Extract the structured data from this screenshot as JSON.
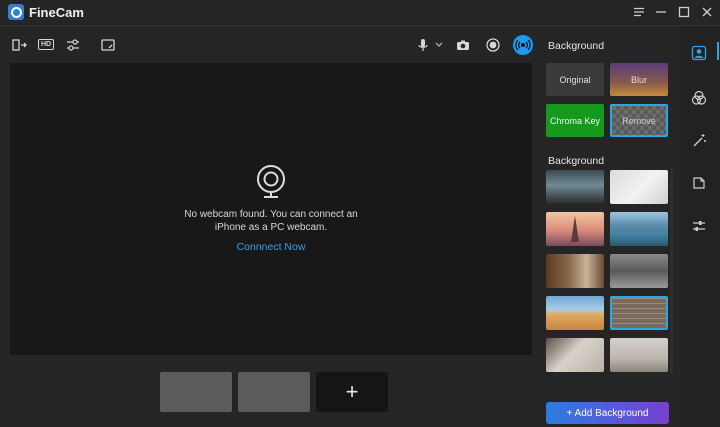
{
  "app": {
    "title": "FineCam"
  },
  "titlebar": {
    "menu_icon": "hamburger-icon",
    "minimize_icon": "minimize-icon",
    "maximize_icon": "maximize-icon",
    "close_icon": "close-icon"
  },
  "toolbar": {
    "hd_label": "HD",
    "left_icons": [
      "mirror-flip-icon",
      "hd-icon",
      "adjust-sliders-icon",
      "whiteboard-icon"
    ],
    "right_icons": [
      "microphone-icon",
      "chevron-down-icon",
      "camera-icon",
      "record-icon",
      "live-broadcast-icon"
    ]
  },
  "preview": {
    "message_line1": "No webcam found. You can connect an",
    "message_line2": "iPhone as a PC webcam.",
    "link": "Connnect Now"
  },
  "thumbs": {
    "add_label": "+"
  },
  "panel": {
    "mode_title": "Background",
    "modes": {
      "original": "Original",
      "blur": "Blur",
      "chroma": "Chroma Key",
      "remove": "Remove"
    },
    "selected_mode": "Remove",
    "backgrounds_title": "Background",
    "backgrounds": [
      {
        "name": "office-interior"
      },
      {
        "name": "white-wall"
      },
      {
        "name": "eiffel-tower"
      },
      {
        "name": "mountain-lake"
      },
      {
        "name": "library-room"
      },
      {
        "name": "modern-office"
      },
      {
        "name": "desert-dunes"
      },
      {
        "name": "brick-wall"
      },
      {
        "name": "plain-room"
      },
      {
        "name": "storefront"
      }
    ],
    "selected_background": "brick-wall",
    "add_button": "+ Add Background"
  },
  "rail": {
    "items": [
      "person-background-icon",
      "color-filter-icon",
      "magic-wand-icon",
      "sticker-icon",
      "settings-sliders-icon"
    ],
    "active": "person-background-icon"
  },
  "colors": {
    "accent": "#2aa7e8",
    "link": "#3ba0e8",
    "chroma_green": "#159a1e"
  }
}
